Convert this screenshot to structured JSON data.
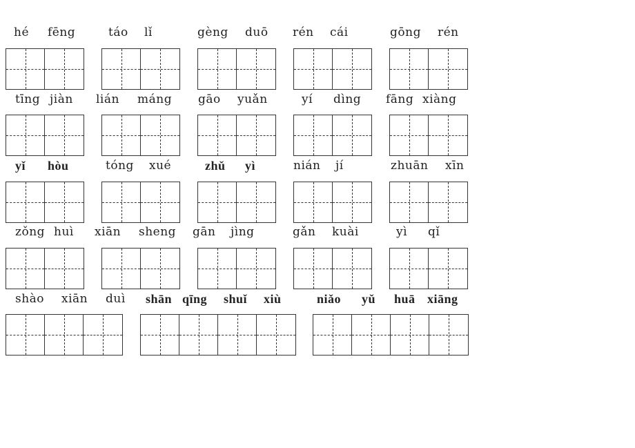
{
  "worksheet": {
    "rows": [
      {
        "items": [
          {
            "words": [
              "hé",
              "fēng"
            ],
            "bold": false,
            "cells": 2
          },
          {
            "words": [
              "táo",
              "lǐ"
            ],
            "bold": false,
            "cells": 2
          },
          {
            "words": [
              "gèng",
              "duō"
            ],
            "bold": false,
            "cells": 2
          },
          {
            "words": [
              "rén",
              "cái"
            ],
            "bold": false,
            "cells": 2
          },
          {
            "words": [
              "gōng",
              "rén"
            ],
            "bold": false,
            "cells": 2
          }
        ]
      },
      {
        "items": [
          {
            "words": [
              "tīng",
              "jiàn"
            ],
            "bold": false,
            "cells": 2
          },
          {
            "words": [
              "lián",
              "máng"
            ],
            "bold": false,
            "cells": 2
          },
          {
            "words": [
              "gāo",
              "yuǎn"
            ],
            "bold": false,
            "cells": 2
          },
          {
            "words": [
              "yí",
              "dìng"
            ],
            "bold": false,
            "cells": 2
          },
          {
            "words": [
              "fāng",
              "xiàng"
            ],
            "bold": false,
            "cells": 2
          }
        ]
      },
      {
        "items": [
          {
            "words": [
              "yǐ",
              "hòu"
            ],
            "bold": true,
            "cells": 2
          },
          {
            "words": [
              "tóng",
              "xué"
            ],
            "bold": false,
            "cells": 2
          },
          {
            "words": [
              "zhǔ",
              "yì"
            ],
            "bold": true,
            "cells": 2
          },
          {
            "words": [
              "nián",
              "jí"
            ],
            "bold": false,
            "cells": 2
          },
          {
            "words": [
              "zhuān",
              "xīn"
            ],
            "bold": false,
            "cells": 2
          }
        ]
      },
      {
        "items": [
          {
            "words": [
              "zǒng",
              "huì"
            ],
            "bold": false,
            "cells": 2
          },
          {
            "words": [
              "xiān",
              "sheng"
            ],
            "bold": false,
            "cells": 2
          },
          {
            "words": [
              "gān",
              "jìng"
            ],
            "bold": false,
            "cells": 2
          },
          {
            "words": [
              "gǎn",
              "kuài"
            ],
            "bold": false,
            "cells": 2
          },
          {
            "words": [
              "yì",
              "qǐ"
            ],
            "bold": false,
            "cells": 2
          }
        ]
      },
      {
        "items": [
          {
            "words": [
              "shào",
              "xiān",
              "duì"
            ],
            "bold": false,
            "cells": 3
          },
          {
            "words": [
              "shān",
              "qīng",
              "shuǐ",
              "xiù"
            ],
            "bold": true,
            "cells": 4
          },
          {
            "words": [
              "niǎo",
              "yǔ",
              "huā",
              "xiāng"
            ],
            "bold": true,
            "cells": 4
          }
        ]
      }
    ]
  }
}
